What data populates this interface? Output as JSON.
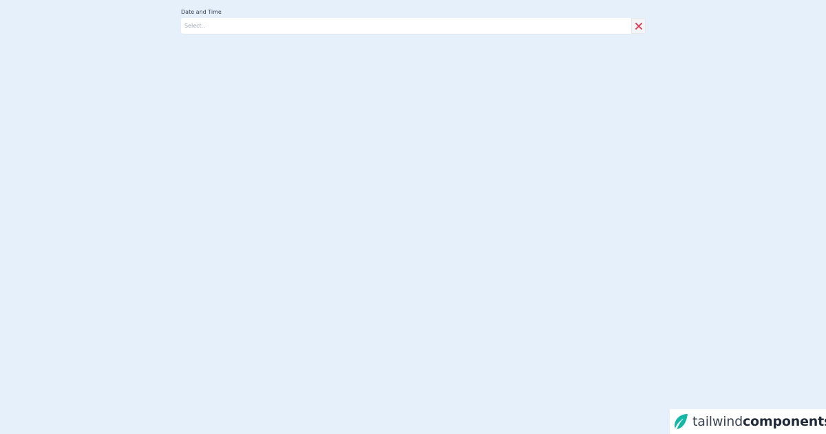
{
  "field": {
    "label": "Date and Time",
    "placeholder": "Select.."
  },
  "clear_button": {
    "icon": "close-icon",
    "color": "#e0344e"
  },
  "branding": {
    "icon": "feather-icon",
    "text_light": "tailwind",
    "text_bold": "components",
    "accent": "#14b8a6"
  },
  "colors": {
    "background": "#e6f0fb"
  }
}
